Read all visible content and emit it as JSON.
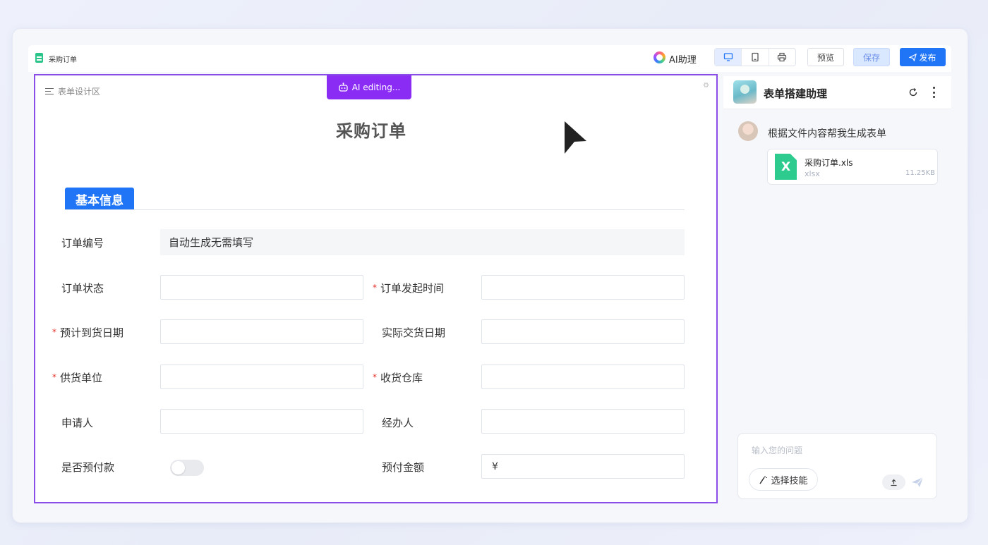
{
  "header": {
    "doc_title": "采购订单",
    "ai_assistant_label": "AI助理",
    "preview_label": "预览",
    "save_label": "保存",
    "publish_label": "发布"
  },
  "canvas": {
    "design_area_label": "表单设计区",
    "ai_editing_label": "AI editing...",
    "form_title": "采购订单",
    "section_title": "基本信息",
    "fields": {
      "order_no": {
        "label": "订单编号",
        "value": "自动生成无需填写"
      },
      "order_status": {
        "label": "订单状态"
      },
      "order_time": {
        "label": "订单发起时间",
        "required": true
      },
      "expected_date": {
        "label": "预计到货日期",
        "required": true
      },
      "actual_date": {
        "label": "实际交货日期"
      },
      "supplier": {
        "label": "供货单位",
        "required": true
      },
      "warehouse": {
        "label": "收货仓库",
        "required": true
      },
      "applicant": {
        "label": "申请人"
      },
      "handler": {
        "label": "经办人"
      },
      "prepay": {
        "label": "是否预付款",
        "toggled": false
      },
      "prepay_amount": {
        "label": "预付金额",
        "currency": "¥"
      }
    },
    "required_mark": "*"
  },
  "assistant": {
    "title": "表单搭建助理",
    "user_message": "根据文件内容帮我生成表单",
    "file": {
      "name": "采购订单.xls",
      "ext": "xlsx",
      "size": "11.25KB",
      "icon_letter": "X"
    },
    "input_placeholder": "输入您的问题",
    "skill_button_label": "选择技能"
  },
  "colors": {
    "accent_blue": "#1f75f5",
    "ai_purple": "#8b2cf5",
    "excel_green": "#2ecb8f",
    "required_red": "#e5302b"
  }
}
